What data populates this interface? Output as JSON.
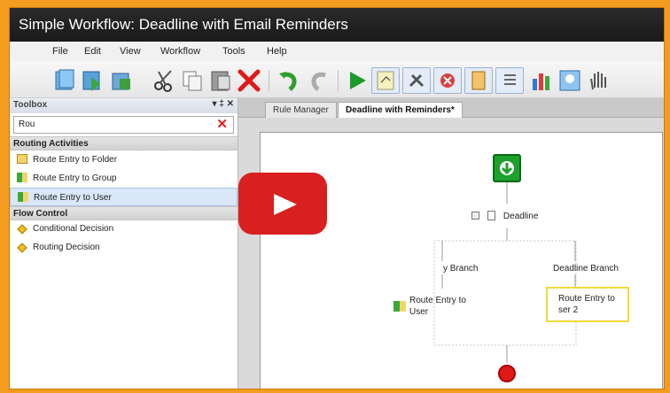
{
  "window": {
    "title": "Simple Workflow: Deadline with Email Reminders"
  },
  "menu": [
    "File",
    "Edit",
    "View",
    "Workflow",
    "Tools",
    "Help"
  ],
  "toolbox": {
    "title": "Toolbox",
    "pin": "▾ ‡ ✕",
    "search_value": "Rou",
    "categories": [
      {
        "label": "Routing Activities",
        "items": [
          "Route Entry to Folder",
          "Route Entry to Group",
          "Route Entry to User"
        ]
      },
      {
        "label": "Flow Control",
        "items": [
          "Conditional Decision",
          "Routing Decision"
        ]
      }
    ]
  },
  "tabs": [
    {
      "label": "Rule Manager",
      "active": false
    },
    {
      "label": "Deadline with Reminders*",
      "active": true
    }
  ],
  "workflow": {
    "deadline_label": "Deadline",
    "branch_left": "y Branch",
    "branch_right": "Deadline Branch",
    "route_left_line1": "Route Entry to",
    "route_left_line2": "User",
    "route_right_line1": "Route Entry to",
    "route_right_line2": "ser 2"
  },
  "video_overlay": {
    "icon": "play-icon",
    "color": "#d8201f"
  }
}
